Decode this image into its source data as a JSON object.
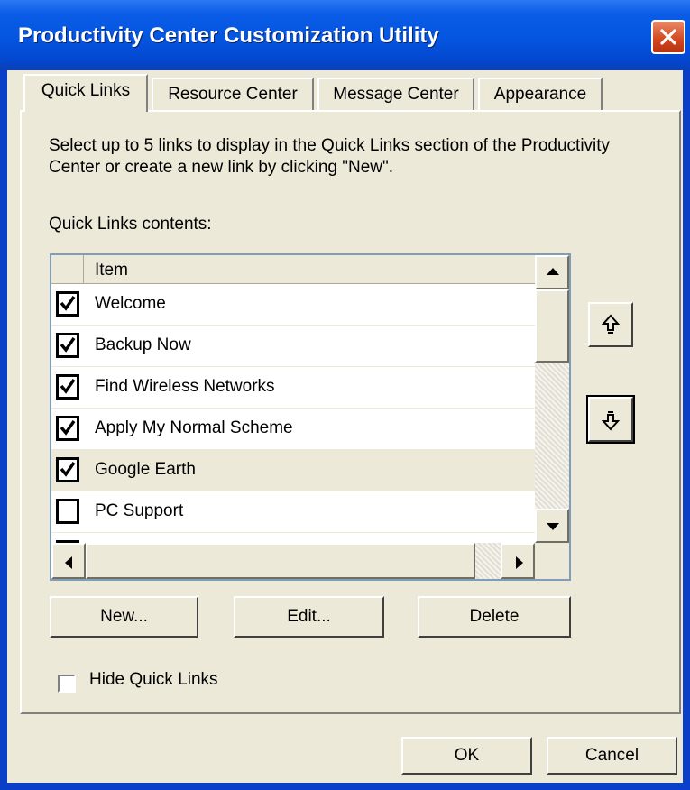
{
  "window": {
    "title": "Productivity Center Customization Utility"
  },
  "tabs": [
    {
      "label": "Quick Links",
      "active": true
    },
    {
      "label": "Resource Center",
      "active": false
    },
    {
      "label": "Message Center",
      "active": false
    },
    {
      "label": "Appearance",
      "active": false
    }
  ],
  "panel": {
    "instructions": "Select up to 5 links to display in the Quick Links section of the Productivity Center or create a new link by clicking \"New\".",
    "contents_label": "Quick Links contents:",
    "list": {
      "column_header": "Item",
      "rows": [
        {
          "label": "Welcome",
          "checked": true,
          "selected": false
        },
        {
          "label": "Backup Now",
          "checked": true,
          "selected": false
        },
        {
          "label": "Find Wireless Networks",
          "checked": true,
          "selected": false
        },
        {
          "label": "Apply My Normal Scheme",
          "checked": true,
          "selected": false
        },
        {
          "label": "Google Earth",
          "checked": true,
          "selected": true
        },
        {
          "label": "PC Support",
          "checked": false,
          "selected": false
        }
      ]
    },
    "move_up_icon": "hollow-arrow-up-icon",
    "move_down_icon": "hollow-arrow-down-icon",
    "new_label": "New...",
    "edit_label": "Edit...",
    "delete_label": "Delete",
    "hide_label": "Hide Quick Links",
    "hide_checked": false
  },
  "footer": {
    "ok_label": "OK",
    "cancel_label": "Cancel"
  },
  "colors": {
    "titlebar": "#0455e0",
    "close": "#d2461f",
    "face": "#ece9d8"
  }
}
